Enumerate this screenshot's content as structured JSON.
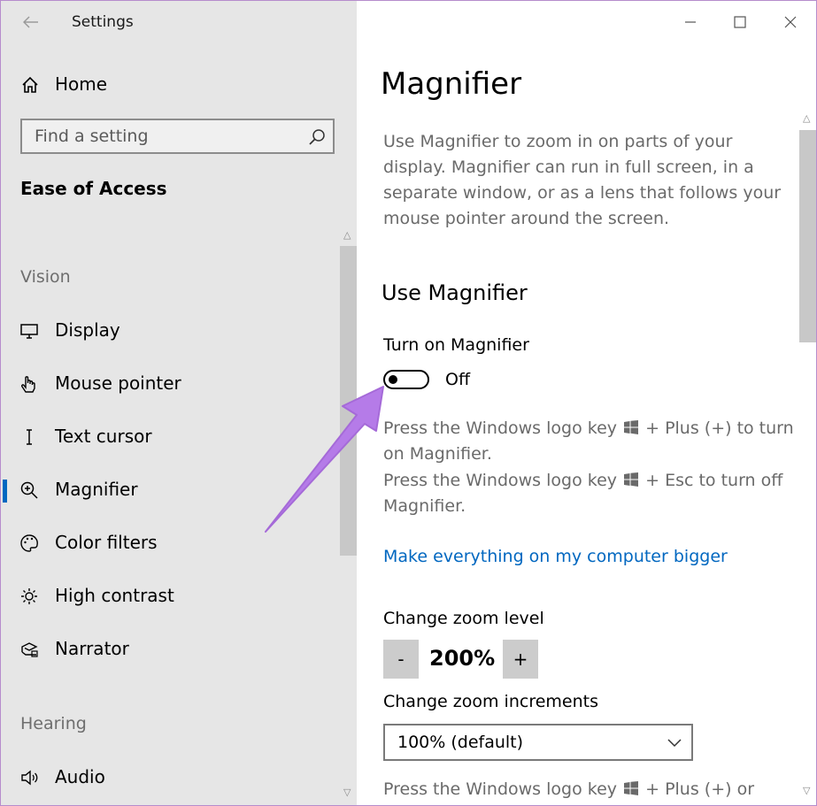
{
  "window": {
    "title": "Settings"
  },
  "sidebar": {
    "home_label": "Home",
    "search_placeholder": "Find a setting",
    "section_title": "Ease of Access",
    "groups": {
      "vision": "Vision",
      "hearing": "Hearing"
    },
    "items": [
      {
        "label": "Display",
        "icon": "monitor-icon"
      },
      {
        "label": "Mouse pointer",
        "icon": "hand-pointer-icon"
      },
      {
        "label": "Text cursor",
        "icon": "text-cursor-icon"
      },
      {
        "label": "Magnifier",
        "icon": "magnifier-icon",
        "active": true
      },
      {
        "label": "Color filters",
        "icon": "palette-icon"
      },
      {
        "label": "High contrast",
        "icon": "sun-icon"
      },
      {
        "label": "Narrator",
        "icon": "narrator-icon"
      },
      {
        "label": "Audio",
        "icon": "speaker-icon"
      }
    ]
  },
  "main": {
    "title": "Magnifier",
    "description": "Use Magnifier to zoom in on parts of your display. Magnifier can run in full screen, in a separate window, or as a lens that follows your mouse pointer around the screen.",
    "use_heading": "Use Magnifier",
    "toggle_label": "Turn on Magnifier",
    "toggle_state": "Off",
    "hint_on_pre": "Press the Windows logo key",
    "hint_on_post": "+ Plus (+) to turn on Magnifier.",
    "hint_off_pre": "Press the Windows logo key",
    "hint_off_post": "+ Esc to turn off Magnifier.",
    "link": "Make everything on my computer bigger",
    "zoom_level_label": "Change zoom level",
    "zoom_minus": "-",
    "zoom_value": "200%",
    "zoom_plus": "+",
    "zoom_increments_label": "Change zoom increments",
    "zoom_increments_value": "100% (default)",
    "hint_bottom_pre": "Press the Windows logo key",
    "hint_bottom_post": "+ Plus (+) or"
  },
  "colors": {
    "accent": "#0067c0",
    "annotation_arrow": "#b57be8",
    "frame": "#b68ccc"
  }
}
